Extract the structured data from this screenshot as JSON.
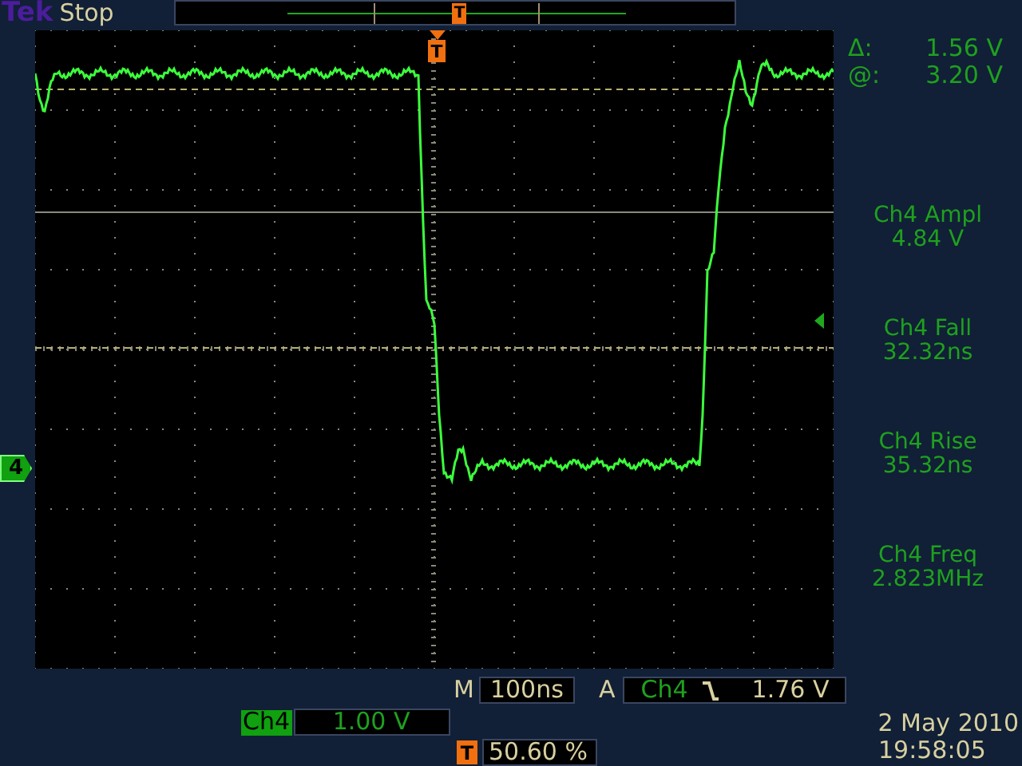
{
  "header": {
    "brand": "Tek",
    "status": "Stop",
    "record_trigger_marker": "T"
  },
  "graticule": {
    "trigger_marker": "T",
    "channel_marker": "4"
  },
  "cursor_readout": [
    {
      "symbol": "Δ:",
      "value": "1.56 V"
    },
    {
      "symbol": "@:",
      "value": "3.20 V"
    }
  ],
  "measurements": [
    {
      "label": "Ch4 Ampl",
      "value": "4.84 V"
    },
    {
      "label": "Ch4 Fall",
      "value": "32.32ns"
    },
    {
      "label": "Ch4 Rise",
      "value": "35.32ns"
    },
    {
      "label": "Ch4 Freq",
      "value": "2.823MHz"
    }
  ],
  "timebase": {
    "label": "M",
    "value": "100ns"
  },
  "trigger": {
    "label": "A",
    "source": "Ch4",
    "falling_edge": true,
    "level": "1.76 V"
  },
  "channel": {
    "name": "Ch4",
    "scale": "1.00 V"
  },
  "trigger_position": {
    "marker": "T",
    "value": "50.60 %"
  },
  "date": "2 May 2010",
  "time": "19:58:05"
}
